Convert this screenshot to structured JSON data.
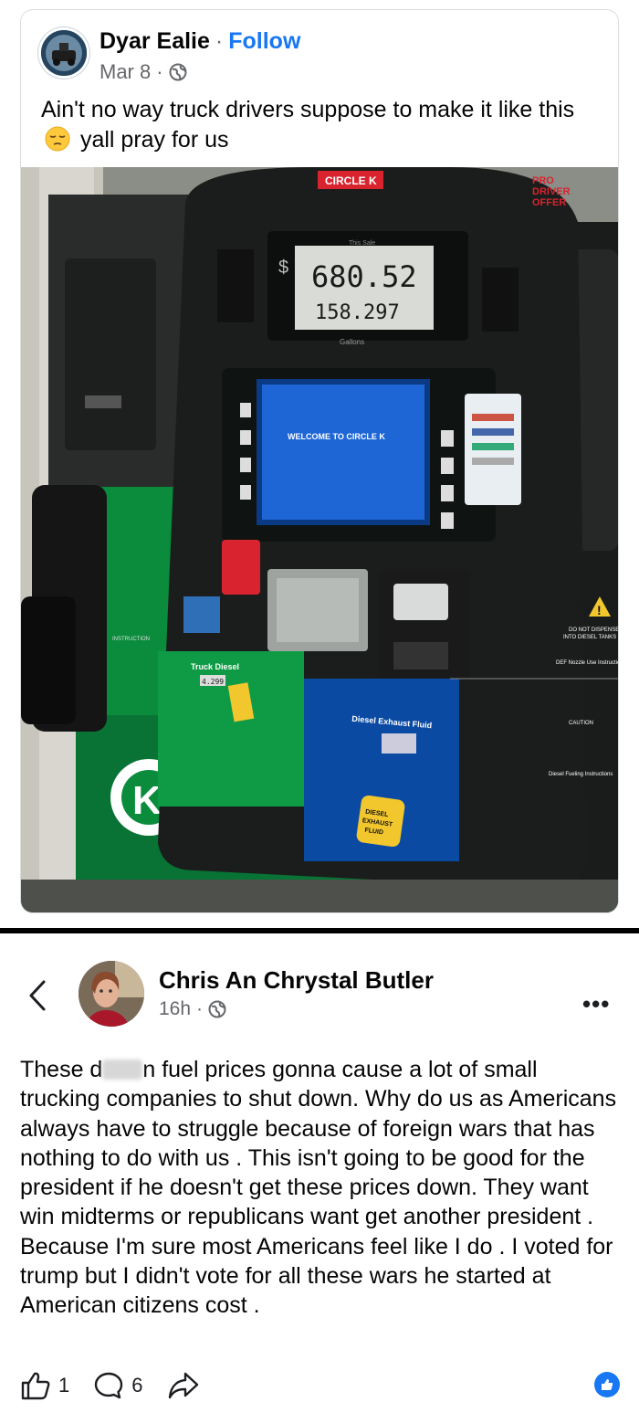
{
  "post1": {
    "author": "Dyar Ealie",
    "separator": "·",
    "follow_label": "Follow",
    "date": "Mar 8",
    "meta_dot": "·",
    "privacy_icon": "globe-icon",
    "text_before": "Ain't no way truck drivers suppose to make it like this",
    "emoji": "pensive-face-emoji",
    "text_after": "yall pray for us",
    "photo": {
      "brand": "CIRCLE K",
      "sale_label": "This Sale",
      "currency": "$",
      "sale_amount": "680.52",
      "gallons": "158.297",
      "gallons_label": "Gallons",
      "screen_text": "WELCOME TO CIRCLE K",
      "promo": "PRO DRIVER OFFER",
      "truck_diesel_label": "Truck Diesel",
      "truck_diesel_price": "4.299",
      "def_label": "Diesel Exhaust Fluid",
      "def_badge": "DIESEL EXHAUST FLUID",
      "warning": "DO NOT DISPENSE INTO DIESEL TANKS OR WITH DIESEL FUEL AS SERIOUS DAMAGE TO THE VEHICLE ENGINE CAN OCCUR",
      "def_nozzle": "DEF Nozzle Use Instructions",
      "caution": "CAUTION",
      "fueling": "Diesel Fueling Instructions",
      "instruction": "INSTRUCTION"
    }
  },
  "post2": {
    "author": "Chris An Chrystal Butler",
    "time": "16h",
    "meta_dot": "·",
    "text_start": "These d",
    "text_rest": "n fuel prices gonna cause a lot of small trucking companies to shut down. Why do us as Americans always have to struggle because of foreign wars that has nothing to do with us . This isn't going to be good for the president if he doesn't get these prices down. They want win midterms or republicans want get another president . Because I'm sure most Americans feel like I do . I voted for trump but I didn't vote for all these wars he started at American citizens cost .",
    "more_label": "•••",
    "likes": "1",
    "comments": "6"
  },
  "colors": {
    "link_blue": "#1877f2",
    "meta_gray": "#65676b",
    "pump_green": "#0a8c3c",
    "pump_blue": "#0b4aa3",
    "screen_blue": "#1e66d6",
    "circle_k_red": "#d9232e"
  }
}
